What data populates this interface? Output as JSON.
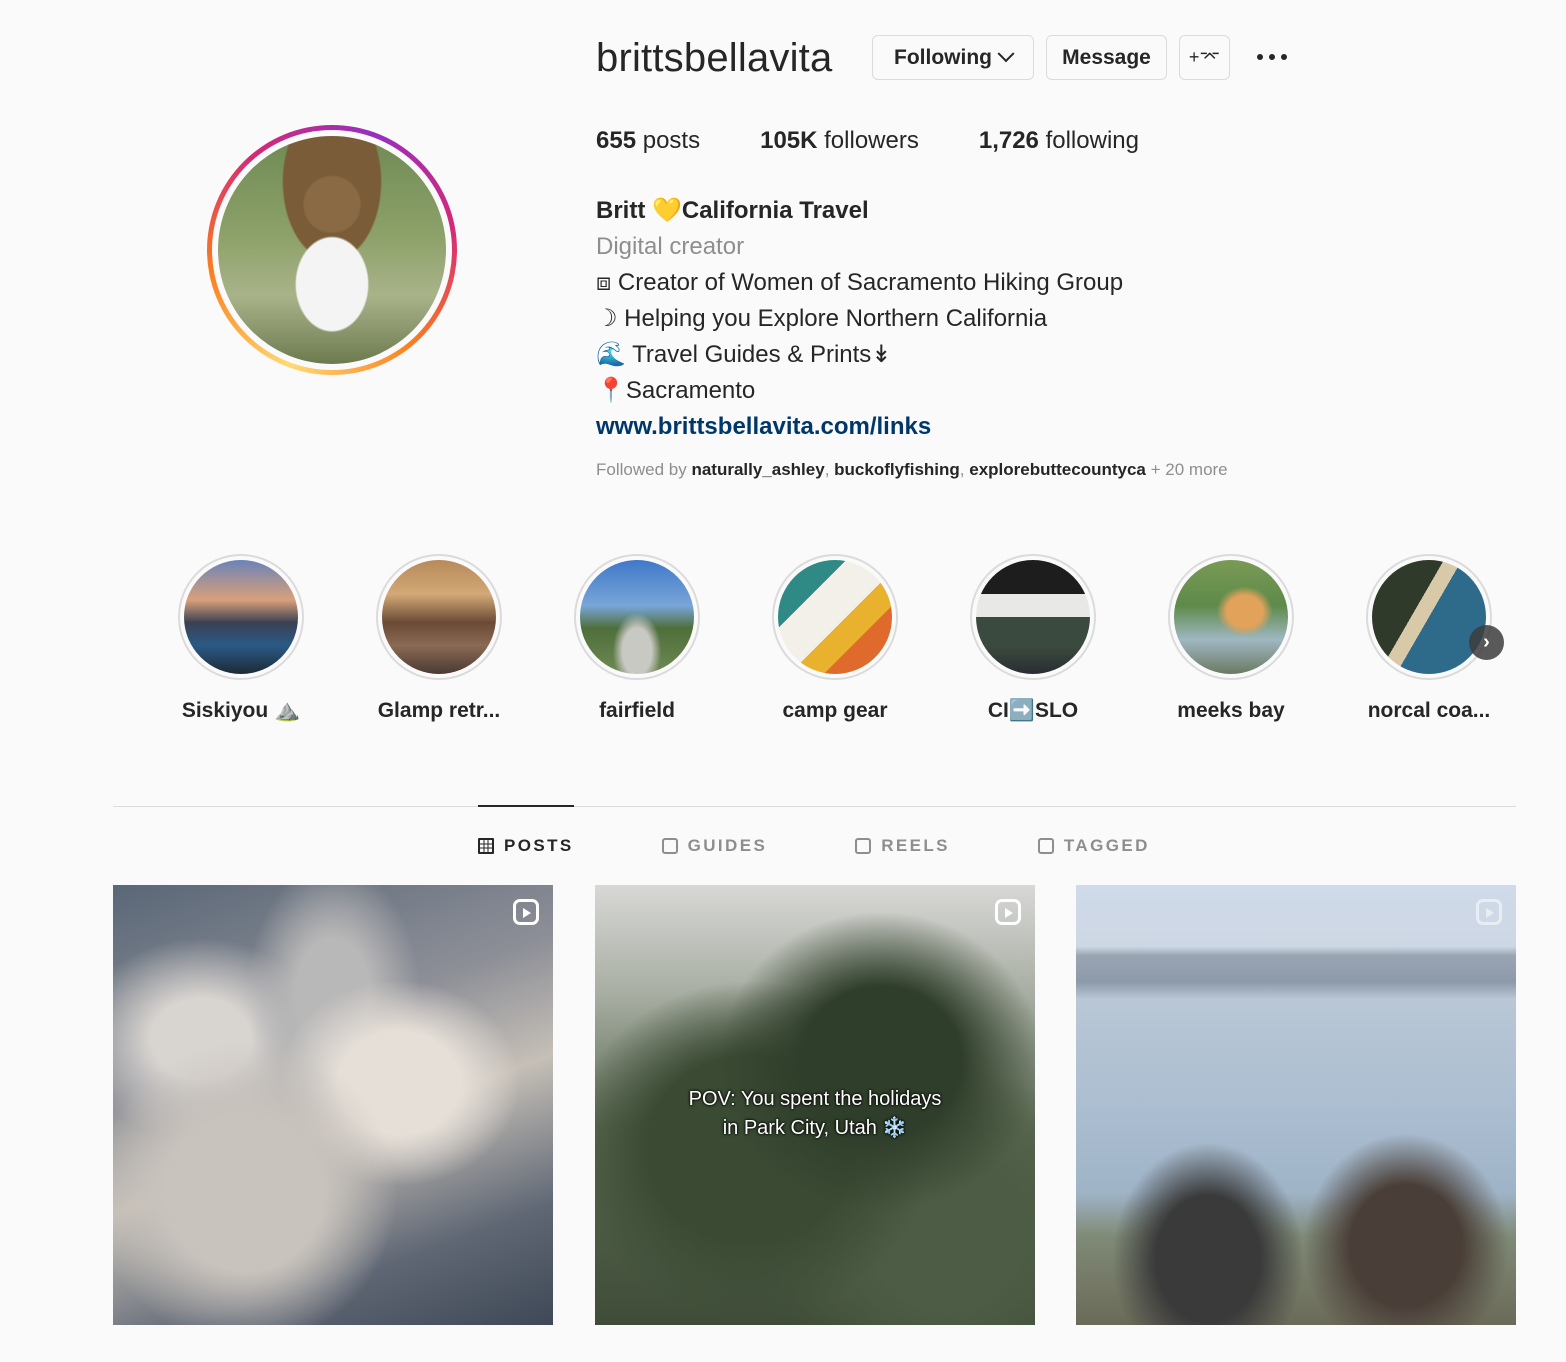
{
  "profile": {
    "username": "brittsbellavita",
    "following_label": "Following",
    "message_label": "Message",
    "adduser_label": "+⌤",
    "stats": {
      "posts_count": "655",
      "posts_label": "posts",
      "followers_count": "105K",
      "followers_label": "followers",
      "following_count": "1,726",
      "following_label": "following"
    },
    "bio": {
      "name": "Britt 💛California Travel",
      "category": "Digital creator",
      "line1": "⧈ Creator of Women of Sacramento Hiking Group",
      "line2": "☽ Helping you Explore Northern California",
      "line3": "🌊 Travel Guides & Prints↡",
      "line4": "📍Sacramento",
      "link": "www.brittsbellavita.com/links"
    },
    "followed_by": {
      "prefix": "Followed by",
      "user1": "naturally_ashley",
      "user2": "buckoflyfishing",
      "user3": "explorebuttecountyca",
      "more": "+ 20 more"
    }
  },
  "highlights": [
    {
      "label": "Siskiyou ⛰️"
    },
    {
      "label": "Glamp retr..."
    },
    {
      "label": "fairfield"
    },
    {
      "label": "camp gear"
    },
    {
      "label": "CI➡️SLO"
    },
    {
      "label": "meeks bay"
    },
    {
      "label": "norcal coa..."
    }
  ],
  "tabs": {
    "posts": "POSTS",
    "guides": "GUIDES",
    "reels": "REELS",
    "tagged": "TAGGED"
  },
  "posts": [
    {
      "caption": ""
    },
    {
      "caption_line1": "POV: You spent the holidays",
      "caption_line2": "in Park City, Utah ❄️"
    },
    {
      "caption": ""
    }
  ]
}
